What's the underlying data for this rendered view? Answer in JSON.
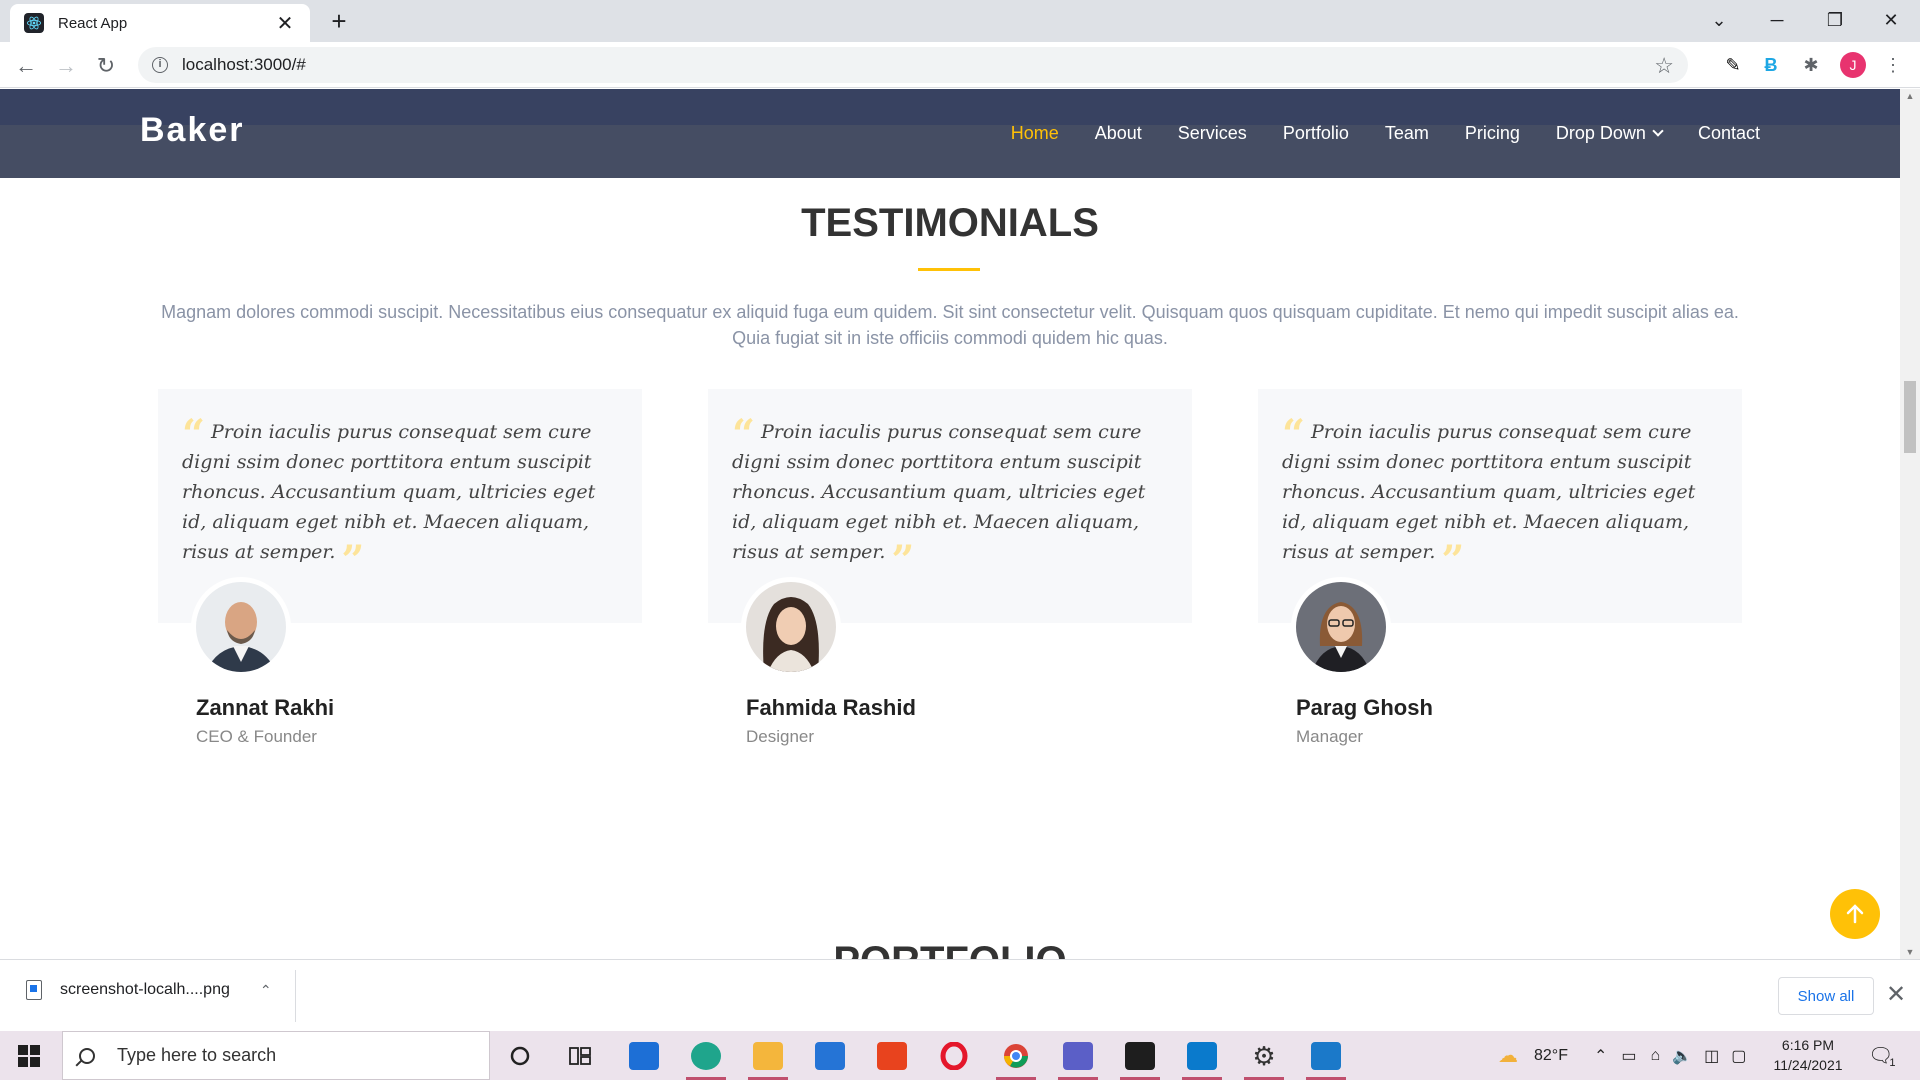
{
  "browser": {
    "tab_title": "React App",
    "url": "localhost:3000/#",
    "profile_initial": "J"
  },
  "site": {
    "logo": "Baker",
    "nav": [
      {
        "label": "Home",
        "active": true
      },
      {
        "label": "About"
      },
      {
        "label": "Services"
      },
      {
        "label": "Portfolio"
      },
      {
        "label": "Team"
      },
      {
        "label": "Pricing"
      },
      {
        "label": "Drop Down"
      },
      {
        "label": "Contact"
      }
    ]
  },
  "testimonials": {
    "title": "TESTIMONIALS",
    "description": "Magnam dolores commodi suscipit. Necessitatibus eius consequatur ex aliquid fuga eum quidem. Sit sint consectetur velit. Quisquam quos quisquam cupiditate. Et nemo qui impedit suscipit alias ea. Quia fugiat sit in iste officiis commodi quidem hic quas.",
    "items": [
      {
        "quote": "Proin iaculis purus consequat sem cure digni ssim donec porttitora entum suscipit rhoncus. Accusantium quam, ultricies eget id, aliquam eget nibh et. Maecen aliquam, risus at semper.",
        "name": "Zannat Rakhi",
        "role": "CEO & Founder"
      },
      {
        "quote": "Proin iaculis purus consequat sem cure digni ssim donec porttitora entum suscipit rhoncus. Accusantium quam, ultricies eget id, aliquam eget nibh et. Maecen aliquam, risus at semper.",
        "name": "Fahmida Rashid",
        "role": "Designer"
      },
      {
        "quote": "Proin iaculis purus consequat sem cure digni ssim donec porttitora entum suscipit rhoncus. Accusantium quam, ultricies eget id, aliquam eget nibh et. Maecen aliquam, risus at semper.",
        "name": "Parag Ghosh",
        "role": "Manager"
      }
    ]
  },
  "next_section_title": "PORTFOLIO",
  "colors": {
    "accent": "#ffc107",
    "header": "#454d63"
  },
  "downloads": {
    "file_name": "screenshot-localh....png",
    "show_all": "Show all"
  },
  "taskbar": {
    "search_placeholder": "Type here to search",
    "weather": "82°F",
    "time": "6:16 PM",
    "date": "11/24/2021",
    "notification_count": "1"
  }
}
